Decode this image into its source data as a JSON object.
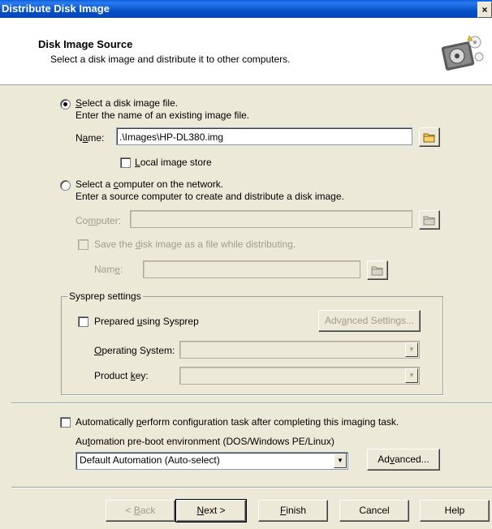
{
  "window": {
    "title": "Distribute Disk Image",
    "close_glyph": "×"
  },
  "header": {
    "title": "Disk Image Source",
    "subtitle": "Select a disk image and distribute it to other computers.",
    "icon": "disk-image-icon"
  },
  "source_file": {
    "radio_label_pre": "",
    "radio_label_accel": "S",
    "radio_label_post": "elect a disk image file.",
    "description": "Enter the name of an existing image file.",
    "name_label_pre": "N",
    "name_label_accel": "a",
    "name_label_post": "me:",
    "name_value": ".\\Images\\HP-DL380.img",
    "local_store_accel": "L",
    "local_store_post": "ocal image store",
    "selected": true
  },
  "source_computer": {
    "radio_label_pre": "Select a ",
    "radio_label_accel": "c",
    "radio_label_post": "omputer on the network.",
    "description": "Enter a source computer to create and distribute a disk image.",
    "computer_label_pre": "Co",
    "computer_label_accel": "m",
    "computer_label_post": "puter:",
    "computer_value": "",
    "save_pre": "Save the ",
    "save_accel": "d",
    "save_post": "isk image as a file while distributing.",
    "name_label_pre": "Nam",
    "name_label_accel": "e",
    "name_label_post": ":",
    "name_value": ""
  },
  "sysprep": {
    "legend": "Sysprep settings",
    "prepared_pre": "Prepared ",
    "prepared_accel": "u",
    "prepared_post": "sing Sysprep",
    "advanced_pre": "Adv",
    "advanced_accel": "a",
    "advanced_post": "nced Settings...",
    "os_label_accel": "O",
    "os_label_post": "perating System:",
    "os_value": "",
    "key_label_pre": "Product ",
    "key_label_accel": "k",
    "key_label_post": "ey:",
    "key_value": ""
  },
  "automation": {
    "auto_pre": "Automatically ",
    "auto_accel": "p",
    "auto_post": "erform configuration task after completing this imaging task.",
    "env_label_pre": "Au",
    "env_label_accel": "t",
    "env_label_post": "omation pre-boot environment (DOS/Windows PE/Linux)",
    "env_value": "Default Automation (Auto-select)",
    "advanced_pre": "Ad",
    "advanced_accel": "v",
    "advanced_post": "anced..."
  },
  "footer": {
    "back_pre": "< ",
    "back_accel": "B",
    "back_post": "ack",
    "next_accel": "N",
    "next_post": "ext >",
    "finish_accel": "F",
    "finish_post": "inish",
    "cancel_label": "Cancel",
    "help_label": "Help"
  },
  "colors": {
    "title_bar": "#0650c8",
    "dialog_bg": "#ece9d8",
    "disabled_text": "#a19c8e"
  }
}
